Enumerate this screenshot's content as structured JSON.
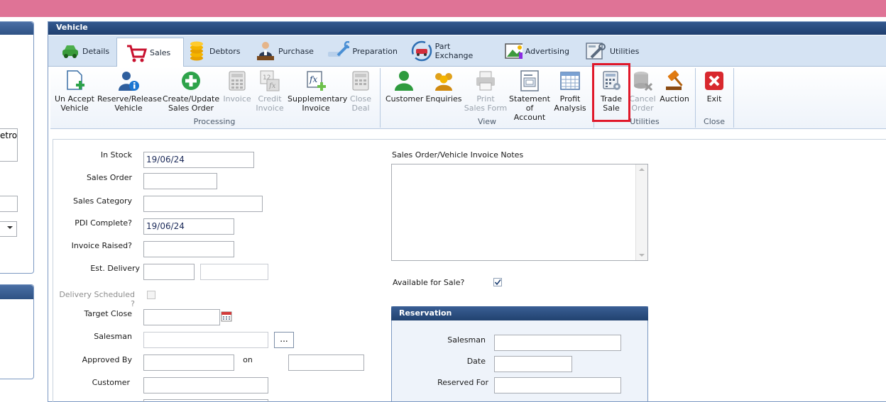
{
  "left_panel": {
    "fuel_fragment": "etrol"
  },
  "vehicle": {
    "title": "Vehicle",
    "tabs": [
      {
        "label": "Details"
      },
      {
        "label": "Sales"
      },
      {
        "label": "Debtors"
      },
      {
        "label": "Purchase"
      },
      {
        "label": "Preparation"
      },
      {
        "label": "Part Exchange"
      },
      {
        "label": "Advertising"
      },
      {
        "label": "Utilities"
      }
    ],
    "active_tab": "Sales"
  },
  "ribbon": {
    "processing": {
      "label": "Processing",
      "buttons": [
        {
          "l1": "Un Accept",
          "l2": "Vehicle",
          "enabled": true
        },
        {
          "l1": "Reserve/Release",
          "l2": "Vehicle",
          "enabled": true
        },
        {
          "l1": "Create/Update",
          "l2": "Sales Order",
          "enabled": true
        },
        {
          "l1": "Invoice",
          "l2": "",
          "enabled": false
        },
        {
          "l1": "Credit",
          "l2": "Invoice",
          "enabled": false
        },
        {
          "l1": "Supplementary",
          "l2": "Invoice",
          "enabled": true
        },
        {
          "l1": "Close",
          "l2": "Deal",
          "enabled": false
        }
      ]
    },
    "view": {
      "label": "View",
      "buttons": [
        {
          "l1": "Customer",
          "l2": "",
          "enabled": true
        },
        {
          "l1": "Enquiries",
          "l2": "",
          "enabled": true
        },
        {
          "l1": "Print",
          "l2": "Sales Form",
          "enabled": false
        },
        {
          "l1": "Statement",
          "l2": "of Account",
          "enabled": true
        },
        {
          "l1": "Profit",
          "l2": "Analysis",
          "enabled": true
        }
      ]
    },
    "utilities": {
      "label": "Utilities",
      "buttons": [
        {
          "l1": "Trade",
          "l2": "Sale",
          "enabled": true
        },
        {
          "l1": "Cancel",
          "l2": "Order",
          "enabled": false
        },
        {
          "l1": "Auction",
          "l2": "",
          "enabled": true
        }
      ]
    },
    "close": {
      "label": "Close",
      "buttons": [
        {
          "l1": "Exit",
          "l2": "",
          "enabled": true
        }
      ]
    }
  },
  "form": {
    "in_stock": {
      "label": "In Stock",
      "value": "19/06/24"
    },
    "sales_order": {
      "label": "Sales Order",
      "value": ""
    },
    "sales_category": {
      "label": "Sales Category",
      "value": ""
    },
    "pdi_complete": {
      "label": "PDI Complete?",
      "value": "19/06/24"
    },
    "invoice_raised": {
      "label": "Invoice Raised?",
      "value": ""
    },
    "est_delivery": {
      "label": "Est. Delivery",
      "value": ""
    },
    "delivery_scheduled": {
      "label": "Delivery Scheduled ?",
      "checked": false
    },
    "target_close": {
      "label": "Target Close",
      "value": ""
    },
    "salesman": {
      "label": "Salesman",
      "value": "",
      "browse_label": "..."
    },
    "approved_by": {
      "label": "Approved By",
      "value": "",
      "on_label": "on",
      "on_value": ""
    },
    "customer": {
      "label": "Customer",
      "value": ""
    },
    "notes_label": "Sales Order/Vehicle Invoice Notes",
    "notes_value": "",
    "available_for_sale": {
      "label": "Available for Sale?",
      "checked": true
    }
  },
  "reservation": {
    "title": "Reservation",
    "salesman": {
      "label": "Salesman",
      "value": ""
    },
    "date": {
      "label": "Date",
      "value": ""
    },
    "reserved_for": {
      "label": "Reserved For",
      "value": ""
    }
  },
  "colors": {
    "title_bar": "#df7396",
    "panel_header": "#2b4c7e",
    "ribbon_bg": "#eef3fa",
    "highlight": "#e0182a"
  }
}
